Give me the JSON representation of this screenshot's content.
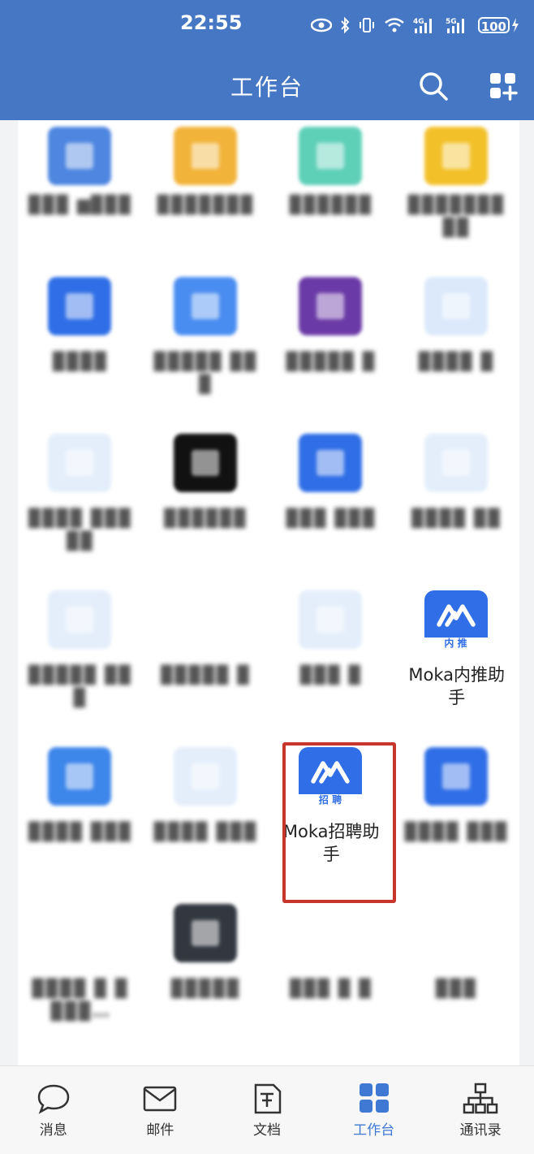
{
  "status_bar": {
    "time": "22:55",
    "battery": "100",
    "icons": [
      "eye-icon",
      "bluetooth-icon",
      "vibrate-icon",
      "wifi-icon",
      "4g-signal-icon",
      "5g-signal-icon",
      "battery-icon",
      "charging-icon"
    ]
  },
  "header": {
    "title": "工作台",
    "actions": [
      "search-icon",
      "add-app-icon"
    ],
    "bg_color": "#4677c4"
  },
  "apps": [
    {
      "label": "▉▉▉ ▆▉▉▉",
      "icon": "blurred-app-icon",
      "color": "#4e86e0"
    },
    {
      "label": "▉▉▉▉▉▉▉",
      "icon": "blurred-app-icon",
      "color": "#f2b33a"
    },
    {
      "label": "▉▉▉▉▉▉",
      "icon": "blurred-app-icon",
      "color": "#5fd0b8"
    },
    {
      "label": "▉▉▉▉▉▉▉ ▉▉",
      "icon": "blurred-app-icon",
      "color": "#f2c12a"
    },
    {
      "label": "▉▉▉▉",
      "icon": "blurred-app-icon",
      "color": "#2f6ee6"
    },
    {
      "label": "▉▉▉▉▉ ▉▉▉",
      "icon": "blurred-app-icon",
      "color": "#4a8df0"
    },
    {
      "label": "▉▉▉▉▉ ▉",
      "icon": "blurred-app-icon",
      "color": "#6a3aa6"
    },
    {
      "label": "▉▉▉▉ ▉",
      "icon": "blurred-app-icon",
      "color": "#dbe9fb"
    },
    {
      "label": "▉▉▉▉ ▉▉▉▉▉",
      "icon": "blurred-app-icon",
      "color": "#e4eefb"
    },
    {
      "label": "▉▉▉▉▉▉",
      "icon": "blurred-app-icon",
      "color": "#111111"
    },
    {
      "label": "▉▉▉ ▉▉▉",
      "icon": "blurred-app-icon",
      "color": "#2f6ee6"
    },
    {
      "label": "▉▉▉▉ ▉▉",
      "icon": "blurred-app-icon",
      "color": "#e4eefb"
    },
    {
      "label": "▉▉▉▉▉ ▉▉▉",
      "icon": "blurred-app-icon",
      "color": "#e4eefb"
    },
    {
      "label": "▉▉▉▉▉ ▉",
      "icon": "blurred-app-icon",
      "color": "#ffffff"
    },
    {
      "label": "▉▉▉ ▉",
      "icon": "blurred-app-icon",
      "color": "#e4eefb"
    },
    {
      "label": "Moka内推助手",
      "icon": "moka-referral-icon",
      "color": "#2f6ee6",
      "badge": "内 推"
    },
    {
      "label": "▉▉▉▉ ▉▉▉",
      "icon": "blurred-app-icon",
      "color": "#3d86ea"
    },
    {
      "label": "▉▉▉▉ ▉▉▉",
      "icon": "blurred-app-icon",
      "color": "#e4eefb"
    },
    {
      "label": "Moka招聘助手",
      "icon": "moka-recruit-icon",
      "color": "#2f6ee6",
      "badge": "招 聘"
    },
    {
      "label": "▉▉▉▉ ▉▉▉",
      "icon": "blurred-app-icon",
      "color": "#2f6ee6"
    },
    {
      "label": "▉▉▉▉ ▉ ▉ ▉▉▉…",
      "icon": "blurred-app-icon",
      "color": "#ffffff"
    },
    {
      "label": "▉▉▉▉▉",
      "icon": "blurred-app-icon",
      "color": "#333840"
    },
    {
      "label": "▉▉▉ ▉ ▉",
      "icon": "blurred-app-icon",
      "color": "#ffffff"
    },
    {
      "label": "▉▉▉",
      "icon": "blurred-app-icon",
      "color": "#ffffff"
    }
  ],
  "tabs": [
    {
      "label": "消息",
      "icon": "chat-bubble-icon",
      "active": false
    },
    {
      "label": "邮件",
      "icon": "mail-icon",
      "active": false
    },
    {
      "label": "文档",
      "icon": "document-icon",
      "active": false
    },
    {
      "label": "工作台",
      "icon": "workbench-grid-icon",
      "active": true
    },
    {
      "label": "通讯录",
      "icon": "org-chart-icon",
      "active": false
    }
  ],
  "accent_color": "#3f79d4",
  "highlight_color": "#c8352a"
}
